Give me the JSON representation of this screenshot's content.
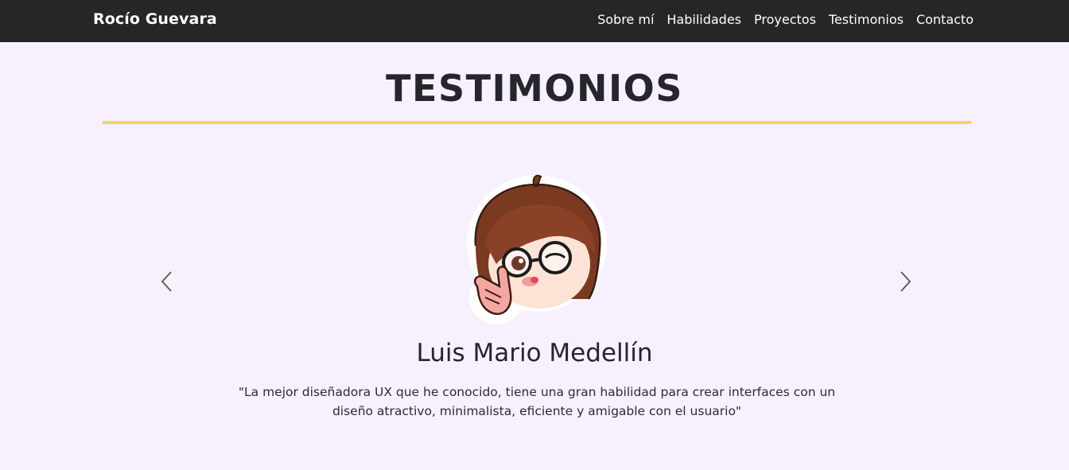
{
  "brand": "Rocío Guevara",
  "nav": {
    "items": [
      {
        "label": "Sobre mí"
      },
      {
        "label": "Habilidades"
      },
      {
        "label": "Proyectos"
      },
      {
        "label": "Testimonios"
      },
      {
        "label": "Contacto"
      }
    ]
  },
  "section": {
    "title": "TESTIMONIOS"
  },
  "testimonial": {
    "name": "Luis Mario Medellín",
    "quote": "\"La mejor diseñadora UX que he conocido, tiene una gran habilidad para crear interfaces con un diseño atractivo, minimalista, eficiente y amigable con el usuario\""
  },
  "colors": {
    "navbar": "#262626",
    "background": "#f6f1fd",
    "accent_rule": "#f7d35c",
    "text": "#26252b"
  },
  "icons": {
    "prev": "chevron-left-icon",
    "next": "chevron-right-icon"
  }
}
